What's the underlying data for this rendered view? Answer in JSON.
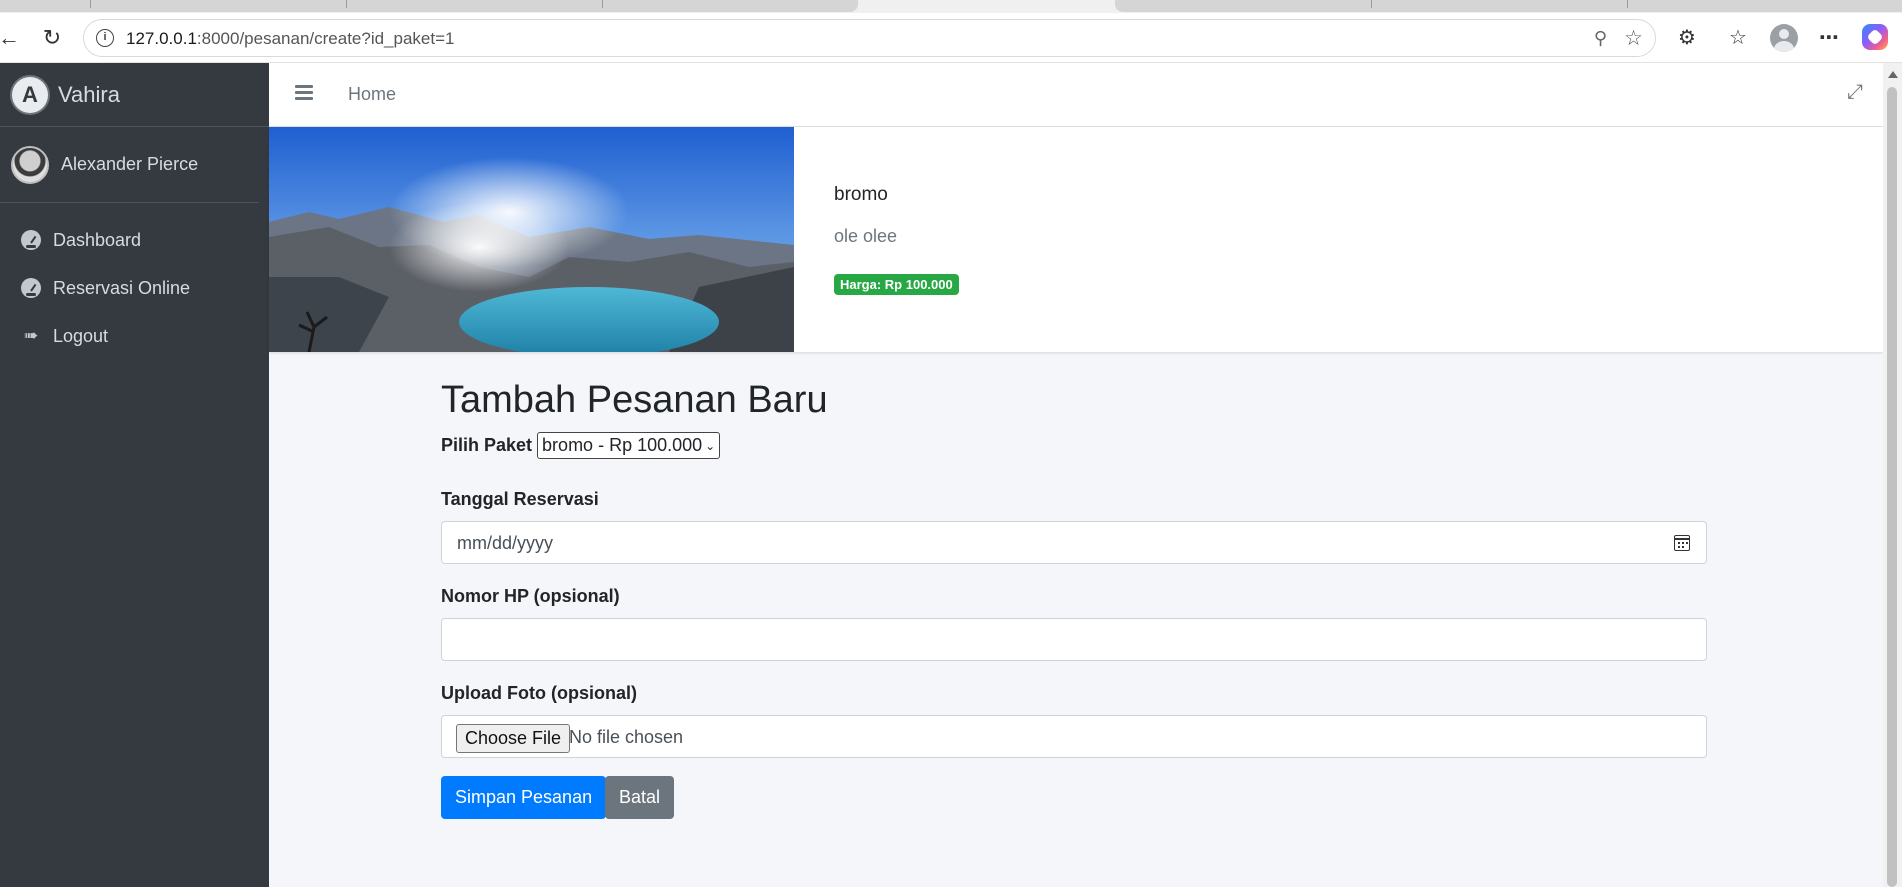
{
  "browser": {
    "url_host": "127.0.0.1",
    "url_path": ":8000/pesanan/create?id_paket=1",
    "back_icon": "back-arrow-icon",
    "reload_icon": "reload-icon"
  },
  "sidebar": {
    "brand": {
      "logo_letter": "A",
      "name": "Vahira"
    },
    "user": {
      "name": "Alexander Pierce"
    },
    "items": [
      {
        "label": "Dashboard",
        "icon": "dashboard-gauge-icon"
      },
      {
        "label": "Reservasi Online",
        "icon": "dashboard-gauge-icon"
      },
      {
        "label": "Logout",
        "icon": "sign-out-icon"
      }
    ]
  },
  "header": {
    "home_label": "Home"
  },
  "package": {
    "title": "bromo",
    "description": "ole olee",
    "price_badge": "Harga: Rp 100.000"
  },
  "form": {
    "title": "Tambah Pesanan Baru",
    "paket_label": "Pilih Paket",
    "paket_selected": "bromo - Rp 100.000",
    "tanggal_label": "Tanggal Reservasi",
    "tanggal_placeholder": "mm/dd/yyyy",
    "hp_label": "Nomor HP (opsional)",
    "hp_value": "",
    "foto_label": "Upload Foto (opsional)",
    "file_button": "Choose File",
    "file_status": "No file chosen",
    "submit_label": "Simpan Pesanan",
    "cancel_label": "Batal"
  },
  "colors": {
    "sidebar_bg": "#343a40",
    "primary": "#007bff",
    "secondary": "#6c757d",
    "success": "#28a745",
    "content_bg": "#f4f6f9"
  }
}
